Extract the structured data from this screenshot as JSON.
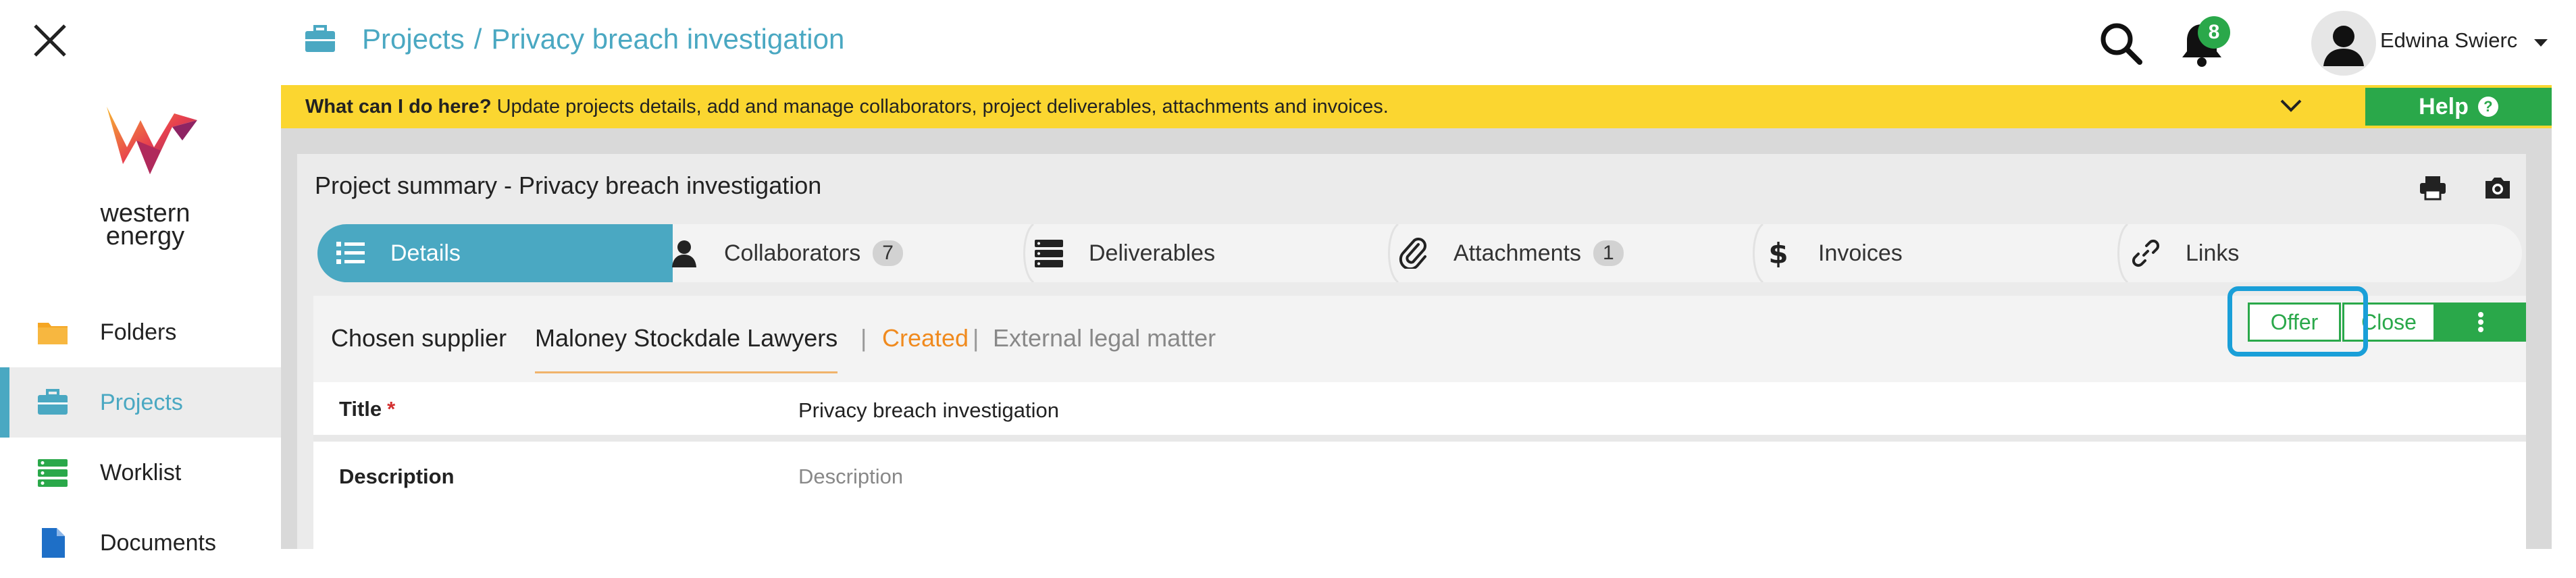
{
  "header": {
    "breadcrumb_root": "Projects",
    "breadcrumb_sep": "/",
    "breadcrumb_current": "Privacy breach investigation",
    "notification_count": "8",
    "user_name": "Edwina Swierc"
  },
  "sidebar": {
    "logo_line1": "western",
    "logo_line2": "energy",
    "items": [
      {
        "label": "Folders",
        "icon": "folder-icon",
        "color": "#f5a623"
      },
      {
        "label": "Projects",
        "icon": "briefcase-icon",
        "color": "#4aa8c2",
        "active": true
      },
      {
        "label": "Worklist",
        "icon": "list-icon",
        "color": "#2aa84a"
      },
      {
        "label": "Documents",
        "icon": "document-icon",
        "color": "#1e6fc7"
      }
    ]
  },
  "helpbar": {
    "lead": "What can I do here?",
    "text": "Update projects details, add and manage collaborators, project deliverables, attachments and invoices.",
    "help_label": "Help"
  },
  "card": {
    "title": "Project summary - Privacy breach investigation"
  },
  "tabs": [
    {
      "label": "Details",
      "icon": "details-list-icon",
      "active": true
    },
    {
      "label": "Collaborators",
      "icon": "person-icon",
      "count": "7"
    },
    {
      "label": "Deliverables",
      "icon": "server-icon"
    },
    {
      "label": "Attachments",
      "icon": "paperclip-icon",
      "count": "1"
    },
    {
      "label": "Invoices",
      "icon": "dollar-icon"
    },
    {
      "label": "Links",
      "icon": "link-icon"
    }
  ],
  "supplier": {
    "chosen_label": "Chosen supplier",
    "name": "Maloney Stockdale Lawyers",
    "pipe": "|",
    "status": "Created",
    "type": "External legal matter"
  },
  "actions": {
    "offer": "Offer",
    "close": "Close"
  },
  "fields": {
    "title_label": "Title",
    "title_required": "*",
    "title_value": "Privacy breach investigation",
    "description_label": "Description",
    "description_placeholder": "Description"
  },
  "colors": {
    "accent": "#4aa8c2",
    "success": "#2aa84a",
    "warning_bar": "#fbd630",
    "status_created": "#f08a1e",
    "focus_ring": "#1a9fd8"
  }
}
